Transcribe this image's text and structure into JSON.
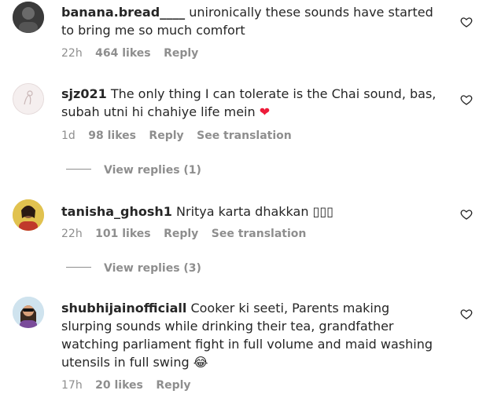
{
  "comments": [
    {
      "username": "banana.bread____",
      "text": "unironically these sounds have started to bring me so much comfort",
      "time": "22h",
      "likes": "464 likes",
      "reply": "Reply",
      "translate": ""
    },
    {
      "username": "sjz021",
      "text": "The only thing I can tolerate is the Chai sound, bas, subah utni hi chahiye life mein",
      "emoji": "❤",
      "time": "1d",
      "likes": "98 likes",
      "reply": "Reply",
      "translate": "See translation",
      "view_replies": "View replies (1)"
    },
    {
      "username": "tanisha_ghosh1",
      "text": "Nritya karta dhakkan ▯▯▯",
      "time": "22h",
      "likes": "101 likes",
      "reply": "Reply",
      "translate": "See translation",
      "view_replies": "View replies (3)"
    },
    {
      "username": "shubhijainofficiall",
      "text": "Cooker ki seeti, Parents making slurping sounds while drinking their tea, grandfather watching parliament fight in full volume and maid washing utensils in full swing",
      "emoji": "😂",
      "time": "17h",
      "likes": "20 likes",
      "reply": "Reply",
      "translate": ""
    }
  ],
  "colors": {
    "text": "#262626",
    "secondary": "#8e8e8e",
    "heart_emoji": "#ed1c3a"
  },
  "icons": {
    "like": "heart-outline-icon"
  }
}
